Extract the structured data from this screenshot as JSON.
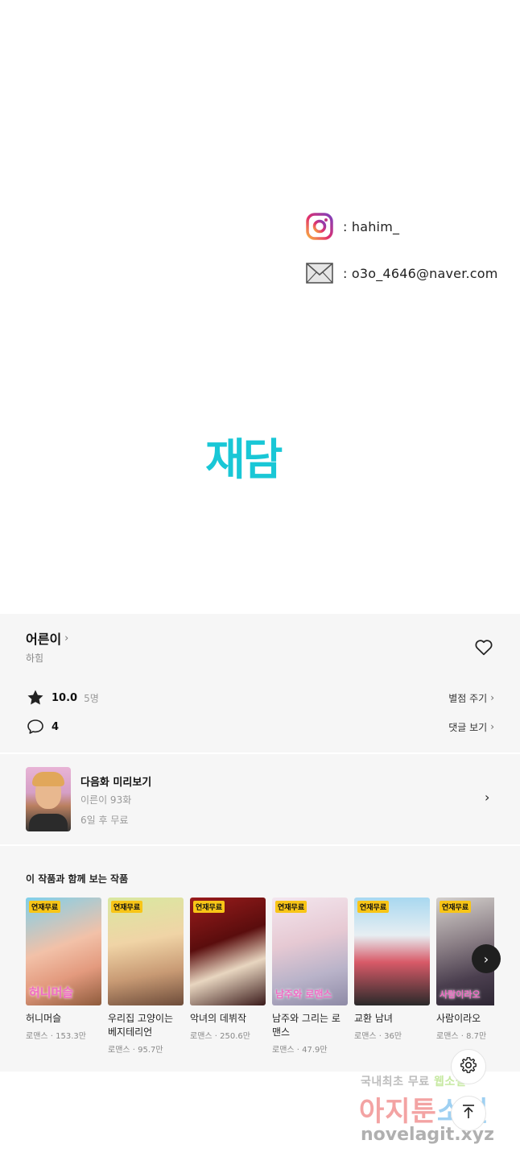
{
  "contacts": {
    "instagram_icon": "instagram-icon",
    "instagram": ": hahim_",
    "mail_icon": "envelope-icon",
    "email": ": o3o_4646@naver.com"
  },
  "logo": {
    "text": "재담",
    "color": "#19c7d6"
  },
  "work": {
    "title": "어른이",
    "author": "하힘",
    "rating": "10.0",
    "raters": "5명",
    "rate_action": "별점 주기",
    "comments": "4",
    "comments_action": "댓글 보기"
  },
  "next_episode": {
    "label": "다음화 미리보기",
    "episode": "이른이 93화",
    "status": "6일 후 무료"
  },
  "recommendations": {
    "title": "이 작품과 함께 보는 작품",
    "items": [
      {
        "badge": "연재무료",
        "cover_text": "허니머슬",
        "name": "허니머슬",
        "meta": "로맨스 · 153.3만"
      },
      {
        "badge": "연재무료",
        "cover_text": "",
        "name": "우리집 고양이는 베지테리언",
        "meta": "로맨스 · 95.7만"
      },
      {
        "badge": "연재무료",
        "cover_text": "",
        "name": "악녀의 데뷔작",
        "meta": "로맨스 · 250.6만"
      },
      {
        "badge": "연재무료",
        "cover_text": "남주와 로맨스",
        "name": "남주와 그리는 로맨스",
        "meta": "로맨스 · 47.9만"
      },
      {
        "badge": "연재무료",
        "cover_text": "",
        "name": "교환 남녀",
        "meta": "로맨스 · 36만"
      },
      {
        "badge": "연재무료",
        "cover_text": "사람이라오",
        "name": "사람이라오",
        "meta": "로맨스 · 8.7만"
      }
    ]
  },
  "watermark": {
    "line1_a": "국내최초 무료 ",
    "line1_b": "웹소설",
    "line2_a": "아지툰",
    "line2_b": "소설",
    "line3": "novelagit.xyz"
  }
}
